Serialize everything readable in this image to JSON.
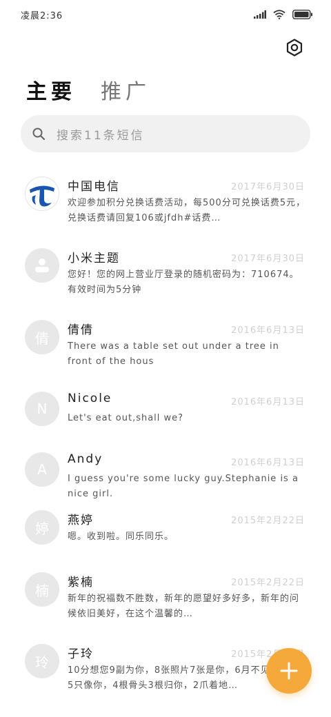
{
  "status_bar": {
    "time": "凌晨2:36"
  },
  "tabs": [
    {
      "label": "主要",
      "active": true
    },
    {
      "label": "推广",
      "active": false
    }
  ],
  "search": {
    "placeholder": "搜索11条短信"
  },
  "colors": {
    "accent": "#f4a93a",
    "avatar_bg": "#e8e8e8",
    "telecom_blue": "#1a56b0"
  },
  "messages": [
    {
      "name": "中国电信",
      "date": "2017年6月30日",
      "preview": "欢迎参加积分兑换话费活动，每500分可兑换话费5元，兑换话费请回复106或jfdh#话费…",
      "avatar_type": "logo",
      "avatar_letter": ""
    },
    {
      "name": "小米主题",
      "date": "2017年6月30日",
      "preview": "您好！您的网上营业厅登录的随机密码为：710674。有效时间为5分钟",
      "avatar_type": "person-icon",
      "avatar_letter": ""
    },
    {
      "name": "倩倩",
      "date": "2016年6月13日",
      "preview": "There was a table set out under a tree in front of the hous",
      "avatar_type": "letter",
      "avatar_letter": "倩"
    },
    {
      "name": "Nicole",
      "date": "2016年6月13日",
      "preview": "Let's eat out,shall we?",
      "avatar_type": "letter",
      "avatar_letter": "N"
    },
    {
      "name": "Andy",
      "date": "2016年6月13日",
      "preview": "I guess you're some lucky guy.Stephanie is a nice girl.",
      "avatar_type": "letter",
      "avatar_letter": "A"
    },
    {
      "name": "燕婷",
      "date": "2015年2月22日",
      "preview": "嗯。收到啦。同乐同乐。",
      "avatar_type": "letter",
      "avatar_letter": "婷"
    },
    {
      "name": "紫楠",
      "date": "2015年2月22日",
      "preview": "新年的祝福数不胜数，新年的愿望好多好多，新年的问候依旧美好，在这个温馨的…",
      "avatar_type": "letter",
      "avatar_letter": "楠"
    },
    {
      "name": "子玲",
      "date": "2015年2月22日",
      "preview": "10分想您9副为你，8张照片7张是你，6月不见我5只狗5只像你，4根骨头3根归你，2爪着地…",
      "avatar_type": "letter",
      "avatar_letter": "玲"
    }
  ],
  "fab": {
    "icon": "plus-icon"
  }
}
